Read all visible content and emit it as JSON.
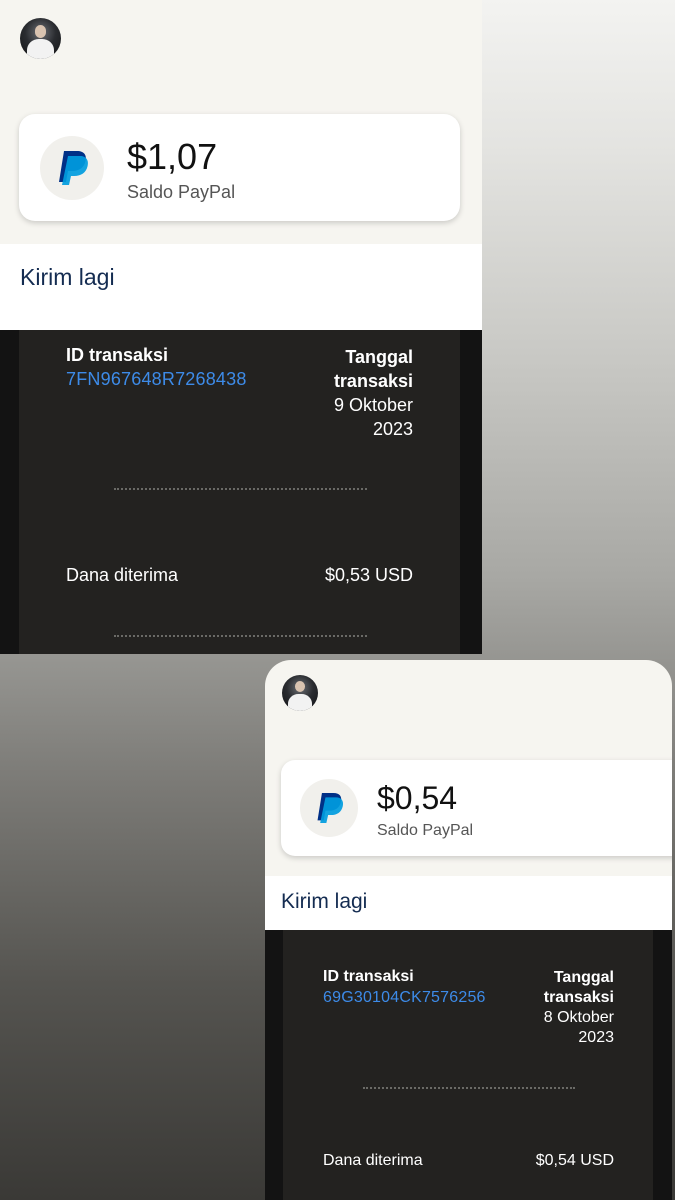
{
  "screenshot_top": {
    "balance": {
      "amount": "$1,07",
      "label": "Saldo PayPal"
    },
    "send_again": "Kirim lagi",
    "transaction": {
      "id_label": "ID transaksi",
      "id_value": "7FN967648R7268438",
      "date_label_line1": "Tanggal",
      "date_label_line2": "transaksi",
      "date_line1": "9 Oktober",
      "date_line2": "2023",
      "received_label": "Dana diterima",
      "received_value": "$0,53 USD"
    }
  },
  "screenshot_bottom": {
    "balance": {
      "amount": "$0,54",
      "label": "Saldo PayPal"
    },
    "send_again": "Kirim lagi",
    "transaction": {
      "id_label": "ID transaksi",
      "id_value": "69G30104CK7576256",
      "date_label_line1": "Tanggal",
      "date_label_line2": "transaksi",
      "date_line1": "8 Oktober",
      "date_line2": "2023",
      "received_label": "Dana diterima",
      "received_value": "$0,54 USD"
    }
  },
  "icons": {
    "brand": "paypal-logo-icon",
    "profile": "avatar"
  },
  "colors": {
    "paypal_dark": "#003087",
    "paypal_light": "#009cde",
    "link_blue": "#3d8be8",
    "navy_text": "#142c51"
  }
}
